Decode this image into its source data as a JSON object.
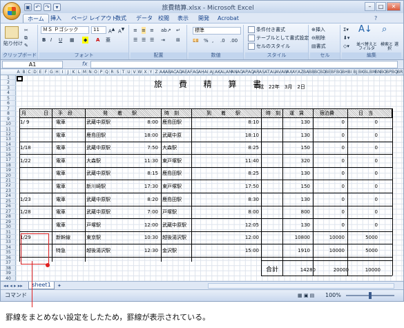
{
  "window": {
    "title": "旅費精算.xlsx - Microsoft Excel",
    "min": "–",
    "max": "□",
    "close": "✕"
  },
  "tabs": [
    "ホーム",
    "挿入",
    "ページ レイアウト",
    "数式",
    "データ",
    "校閲",
    "表示",
    "開発",
    "Acrobat"
  ],
  "ribbon": {
    "clipboard": {
      "label": "クリップボード",
      "paste": "貼り付け"
    },
    "font": {
      "label": "フォント",
      "name": "ＭＳ Ｐゴシック",
      "size": "11"
    },
    "alignment": {
      "label": "配置"
    },
    "number": {
      "label": "数値",
      "format": "標準"
    },
    "styles": {
      "label": "スタイル",
      "cond": "条件付き書式",
      "table": "テーブルとして書式設定",
      "cell": "セルのスタイル"
    },
    "cells": {
      "label": "セル",
      "insert": "挿入",
      "delete": "削除",
      "format": "書式"
    },
    "editing": {
      "label": "編集",
      "sort": "並べ替えと フィルタ",
      "find": "検索と 選択"
    }
  },
  "formula": {
    "namebox": "A1",
    "fx": "fx"
  },
  "sheet": {
    "title": "旅 費 精 算 書",
    "date": "平成　22年　3月　2日",
    "headers": {
      "month": "月",
      "day": "日",
      "method": "手　段",
      "from": "発　　着　　駅",
      "time1": "時　刻",
      "to": "到　　着　　駅",
      "time2": "時　刻",
      "fare": "運　賃",
      "lodging": "宿泊費",
      "daily": "日　当"
    },
    "total_label": "合計",
    "total_fare": "14280",
    "total_lodging": "20000",
    "total_daily": "10000"
  },
  "rows": [
    {
      "date": "1/ 9",
      "method": "電車",
      "from": "武蔵中原駅",
      "t1": "8:00",
      "to": "鹿島田駅",
      "t2": "8:10",
      "fare": "130",
      "lodge": "0",
      "daily": "0"
    },
    {
      "date": "",
      "method": "電車",
      "from": "鹿島田駅",
      "t1": "18:00",
      "to": "武蔵中原",
      "t2": "18:10",
      "fare": "130",
      "lodge": "0",
      "daily": "0"
    },
    {
      "date": "1/18",
      "method": "電車",
      "from": "武蔵中原駅",
      "t1": "7:50",
      "to": "大森駅",
      "t2": "8:25",
      "fare": "150",
      "lodge": "0",
      "daily": "0"
    },
    {
      "date": "1/22",
      "method": "電車",
      "from": "大森駅",
      "t1": "11:30",
      "to": "東戸塚駅",
      "t2": "11:40",
      "fare": "320",
      "lodge": "0",
      "daily": "0"
    },
    {
      "date": "",
      "method": "電車",
      "from": "武蔵中原駅",
      "t1": "8:15",
      "to": "鹿島田駅",
      "t2": "8:25",
      "fare": "130",
      "lodge": "0",
      "daily": "0"
    },
    {
      "date": "",
      "method": "電車",
      "from": "新川崎駅",
      "t1": "17:30",
      "to": "東戸塚駅",
      "t2": "17:50",
      "fare": "150",
      "lodge": "0",
      "daily": "0"
    },
    {
      "date": "1/23",
      "method": "電車",
      "from": "武蔵中原駅",
      "t1": "8:20",
      "to": "鹿島田駅",
      "t2": "8:30",
      "fare": "130",
      "lodge": "0",
      "daily": "0"
    },
    {
      "date": "1/28",
      "method": "電車",
      "from": "武蔵中原駅",
      "t1": "7:00",
      "to": "戸塚駅",
      "t2": "8:00",
      "fare": "800",
      "lodge": "0",
      "daily": "0"
    },
    {
      "date": "",
      "method": "電車",
      "from": "戸塚駅",
      "t1": "12:00",
      "to": "武蔵中原駅",
      "t2": "12:05",
      "fare": "130",
      "lodge": "0",
      "daily": "0"
    },
    {
      "date": "1/29",
      "method": "新幹線",
      "from": "東京駅",
      "t1": "10:30",
      "to": "越後湯沢駅",
      "t2": "12:00",
      "fare": "10800",
      "lodge": "10000",
      "daily": "5000"
    },
    {
      "date": "",
      "method": "特急",
      "from": "越後湯沢駅",
      "t1": "12:30",
      "to": "金沢駅",
      "t2": "15:00",
      "fare": "1910",
      "lodge": "10000",
      "daily": "5000"
    }
  ],
  "sheettab": "sheet1",
  "status": {
    "mode": "コマンド",
    "zoom": "100%"
  },
  "caption": "罫線をまとめない設定をしたため，罫線が表示されている。"
}
